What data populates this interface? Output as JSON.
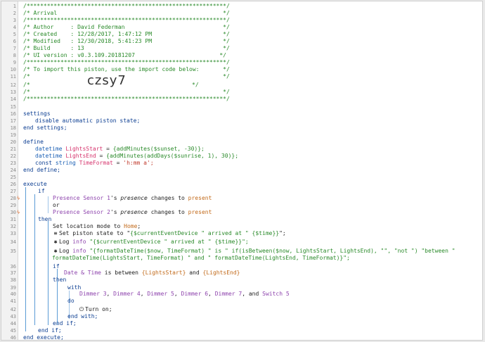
{
  "header": {
    "rule": "/***********************************************************/",
    "title": "/* Arrival                                                 */",
    "author": "/* Author     : David Federman                             */",
    "created": "/* Created    : 12/28/2017, 1:47:12 PM                     */",
    "modified": "/* Modified   : 12/30/2018, 5:41:23 PM                     */",
    "build": "/* Build      : 13                                         */",
    "ui_version": "/* UI version : v0.3.109.20181207                         */",
    "import_text": "/* To import this piston, use the import code below:       */",
    "blank": "/*                                                         */",
    "import_pre": "/*",
    "import_code": "czsy7",
    "import_post": "*/"
  },
  "settings": {
    "open": "settings",
    "body": "disable automatic piston state;",
    "close": "end settings;"
  },
  "define": {
    "open": "define",
    "v1_type": "datetime",
    "v1_name": "LightsStart",
    "v1_eq": " = ",
    "v1_expr": "{addMinutes($sunset, -30)};",
    "v2_type": "datetime",
    "v2_name": "LightsEnd",
    "v2_eq": " = ",
    "v2_expr": "{addMinutes(addDays($sunrise, 1), 30)};",
    "v3_kw": "const",
    "v3_type": "string",
    "v3_name": "TimeFormat",
    "v3_eq": " = ",
    "v3_expr": "'h:mm a';",
    "close": "end define;"
  },
  "execute": {
    "open": "execute",
    "if1": "if",
    "cond1_dev": "Presence Sensor 1",
    "cond1_mid": "'s ",
    "cond1_attr": "presence",
    "cond1_op": " changes to ",
    "cond1_val": "present",
    "or": "or",
    "cond2_dev": "Presence Sensor 2",
    "cond2_mid": "'s ",
    "cond2_attr": "presence",
    "cond2_op": " changes to ",
    "cond2_val": "present",
    "then1": "then",
    "set_mode": "Set location mode to ",
    "set_mode_val": "Home",
    "set_mode_end": ";",
    "set_state": "Set piston state to \"",
    "set_state_expr": "{$currentEventDevice \" arrived at \" {$time}}",
    "set_state_end": "\";",
    "log1_pre": "Log ",
    "log1_level": "info",
    "log1_str": " \"{$currentEventDevice \" arrived at \" {$time}}\";",
    "log2_pre": "Log ",
    "log2_level": "info",
    "log2_str": " \"{formatDateTime($now, TimeFormat) \" is \" if(isBetween($now, LightsStart, LightsEnd), \"\", \"not \") \"between \" formatDateTime(LightsStart, TimeFormat) \" and \" formatDateTime(LightsEnd, TimeFormat)}\";",
    "if2": "if",
    "cond3_dev": "Date & Time",
    "cond3_op": " is between ",
    "cond3_v1": "{LightsStart}",
    "cond3_and": " and ",
    "cond3_v2": "{LightsEnd}",
    "then2": "then",
    "with": "with",
    "devices": [
      "Dimmer 3",
      "Dimmer 4",
      "Dimmer 5",
      "Dimmer 6",
      "Dimmer 7"
    ],
    "dev_sep": ", ",
    "dev_and": ", and ",
    "dev_last": "Switch 5",
    "do": "do",
    "turn_on": "Turn on;",
    "end_with": "end with;",
    "end_if2": "end if;",
    "end_if1": "end if;",
    "close": "end execute;"
  },
  "line_numbers": [
    "1",
    "2",
    "3",
    "4",
    "5",
    "6",
    "7",
    "8",
    "9",
    "10",
    "11",
    "12",
    "13",
    "14",
    "15",
    "16",
    "17",
    "18",
    "19",
    "20",
    "21",
    "22",
    "23",
    "24",
    "25",
    "26",
    "27",
    "28",
    "29",
    "30",
    "31",
    "32",
    "33",
    "34",
    "35",
    "36",
    "37",
    "38",
    "39",
    "40",
    "41",
    "42",
    "43",
    "44",
    "45",
    "46"
  ],
  "markers": {
    "m28": "ϟ",
    "m30": "ϟ"
  },
  "icons": {
    "power": "power-icon",
    "log": "bug-icon",
    "state": "document-icon"
  },
  "colors": {
    "comment": "#2a8a2a",
    "keyword": "#0b3d91",
    "variable": "#d6336c",
    "device": "#8e44ad",
    "value": "#c26a1a",
    "guide": "#5b9bd5"
  }
}
